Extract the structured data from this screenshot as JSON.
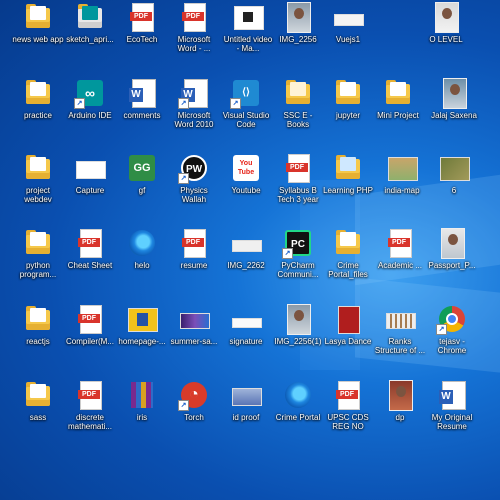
{
  "desktop": {
    "icons": [
      {
        "label": "news web app",
        "kind": "folder"
      },
      {
        "label": "sketch_apri...",
        "kind": "app"
      },
      {
        "label": "EcoTech",
        "kind": "pdf"
      },
      {
        "label": "Microsoft Word - ...",
        "kind": "pdf"
      },
      {
        "label": "Untitled video - Ma...",
        "kind": "thumb"
      },
      {
        "label": "IMG_2256",
        "kind": "photo"
      },
      {
        "label": "Vuejs1",
        "kind": "thumb"
      },
      {
        "label": "O LEVEL",
        "kind": "photo"
      },
      {
        "label": "practice",
        "kind": "folder"
      },
      {
        "label": "Arduino IDE",
        "kind": "app"
      },
      {
        "label": "comments",
        "kind": "word"
      },
      {
        "label": "Microsoft Word 2010",
        "kind": "word"
      },
      {
        "label": "Visual Studio Code",
        "kind": "app"
      },
      {
        "label": "SSC E - Books",
        "kind": "folder"
      },
      {
        "label": "jupyter",
        "kind": "folder"
      },
      {
        "label": "Mini Project",
        "kind": "folder"
      },
      {
        "label": "Jalaj Saxena",
        "kind": "photo"
      },
      {
        "label": "project webdev",
        "kind": "folder"
      },
      {
        "label": "Capture",
        "kind": "thumb"
      },
      {
        "label": "gf",
        "kind": "app"
      },
      {
        "label": "Physics Wallah",
        "kind": "app"
      },
      {
        "label": "Youtube",
        "kind": "app"
      },
      {
        "label": "Syllabus B Tech 3 year",
        "kind": "pdf"
      },
      {
        "label": "Learning PHP",
        "kind": "folder"
      },
      {
        "label": "india-map",
        "kind": "thumb"
      },
      {
        "label": "6",
        "kind": "thumb"
      },
      {
        "label": "python program...",
        "kind": "folder"
      },
      {
        "label": "Cheat Sheet",
        "kind": "pdf"
      },
      {
        "label": "helo",
        "kind": "edge"
      },
      {
        "label": "resume",
        "kind": "pdf"
      },
      {
        "label": "IMG_2262",
        "kind": "thumb"
      },
      {
        "label": "PyCharm Communi...",
        "kind": "app"
      },
      {
        "label": "Crime Portal_files",
        "kind": "folder"
      },
      {
        "label": "Academic ...",
        "kind": "pdf"
      },
      {
        "label": "Passport_P...",
        "kind": "photo"
      },
      {
        "label": "reactjs",
        "kind": "folder"
      },
      {
        "label": "Compiler(M...",
        "kind": "pdf"
      },
      {
        "label": "homepage-...",
        "kind": "thumb"
      },
      {
        "label": "summer-sa...",
        "kind": "thumb"
      },
      {
        "label": "signature",
        "kind": "thumb"
      },
      {
        "label": "IMG_2256(1)",
        "kind": "photo"
      },
      {
        "label": "Lasya Dance",
        "kind": "thumb"
      },
      {
        "label": "Ranks Structure of ...",
        "kind": "thumb"
      },
      {
        "label": "tejasv - Chrome",
        "kind": "chrome"
      },
      {
        "label": "sass",
        "kind": "folder"
      },
      {
        "label": "discrete mathemati...",
        "kind": "pdf"
      },
      {
        "label": "iris",
        "kind": "rar"
      },
      {
        "label": "Torch",
        "kind": "app"
      },
      {
        "label": "id proof",
        "kind": "thumb"
      },
      {
        "label": "Crime Portal",
        "kind": "edge"
      },
      {
        "label": "UPSC CDS REG NO",
        "kind": "pdf"
      },
      {
        "label": "dp",
        "kind": "photo"
      },
      {
        "label": "My Original Resume",
        "kind": "word"
      }
    ],
    "tile_text": {
      "pdf": "PDF",
      "word": "W",
      "gf": "GG",
      "pw": "PW",
      "yt": "You Tube",
      "pc": "PC",
      "arduino": "∞",
      "vscode": "⟨⟩",
      "torch": "◔"
    },
    "colors": {
      "pdf_red": "#d9342b",
      "word_blue": "#2b5fb7",
      "folder_yellow": "#f5c84a",
      "desktop_blue": "#0a4fb0"
    }
  }
}
